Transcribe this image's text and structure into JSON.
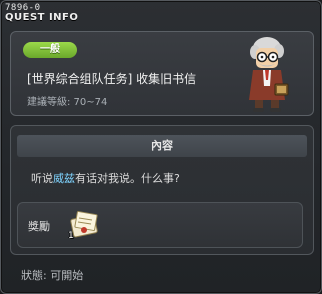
{
  "window": {
    "quest_id": "7896-0",
    "title": "QUEST INFO"
  },
  "quest": {
    "category": "一般",
    "name": "[世界综合组队任务] 收集旧书信",
    "level": "建議等級: 70~74"
  },
  "content": {
    "header": "內容",
    "text_before": "听说",
    "npc_name": "威兹",
    "text_after": "有话对我说。什么事?",
    "npc_name_color": "#7fd4ff"
  },
  "reward": {
    "label": "獎勵",
    "item_icon": "old-letter-icon",
    "count": "1"
  },
  "status": "狀態: 可開始",
  "colors": {
    "category_pill": "#7fc03a",
    "window_bg": "#23262a"
  }
}
